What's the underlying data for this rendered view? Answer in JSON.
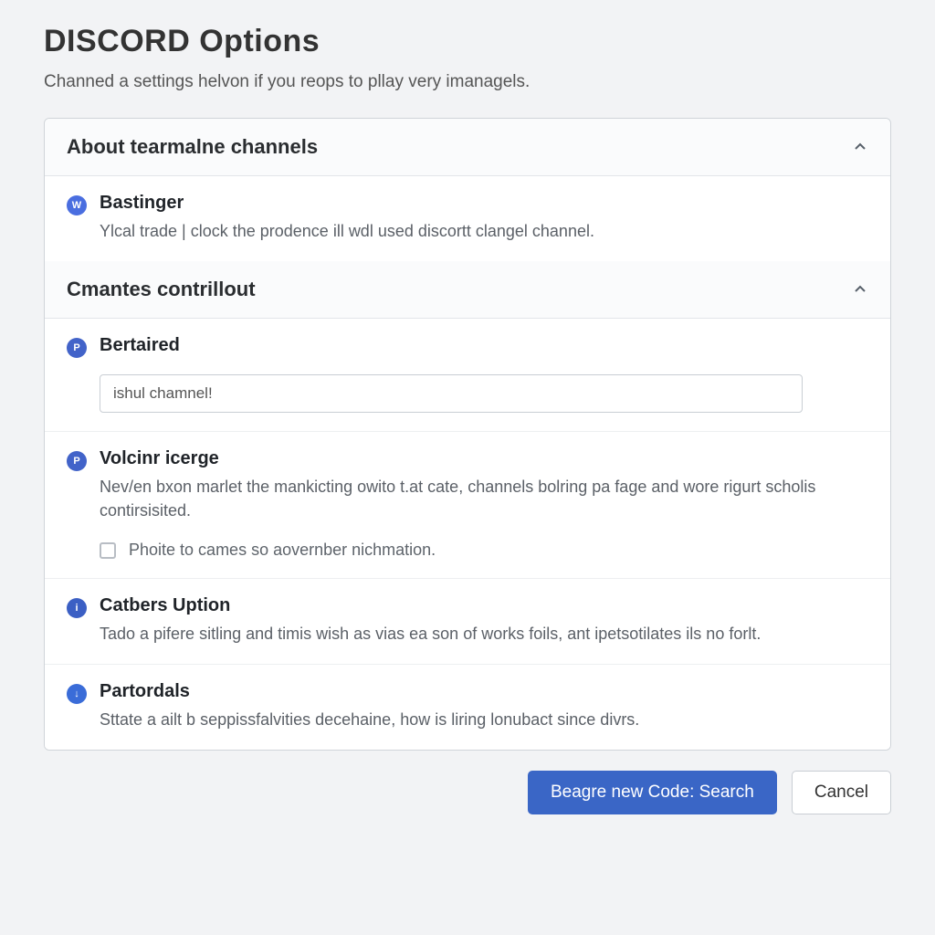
{
  "header": {
    "title": "DISCORD Options",
    "subtitle": "Channed a settings helvon if you reops to pllay very imanagels."
  },
  "sections": {
    "s1": {
      "title": "About tearmalne channels",
      "items": {
        "bastinger": {
          "badge": "W",
          "title": "Bastinger",
          "desc": "Ylcal trade | clock the prodence ill wdl used discortt clangel channel."
        }
      }
    },
    "s2": {
      "title": "Cmantes contrillout",
      "items": {
        "bertaired": {
          "badge": "P",
          "title": "Bertaired",
          "input_value": "ishul chamnel!"
        },
        "volcinr": {
          "badge": "P",
          "title": "Volcinr icerge",
          "desc": "Nev/en bxon marlet the mankicting owito t.at cate, channels bolring pa fage and wore rigurt scholis contirsisited.",
          "checkbox_label": "Phoite to cames so aovernber nichmation."
        },
        "catbers": {
          "badge": "i",
          "title": "Catbers Uption",
          "desc": "Tado a pifere sitling and timis wish as vias ea son of works foils, ant ipetsotilates ils no forlt."
        },
        "partordals": {
          "badge": "↓",
          "title": "Partordals",
          "desc": "Sttate a ailt b seppissfalvities decehaine, how is liring lonubact since divrs."
        }
      }
    }
  },
  "footer": {
    "primary": "Beagre new Code: Search",
    "secondary": "Cancel"
  }
}
